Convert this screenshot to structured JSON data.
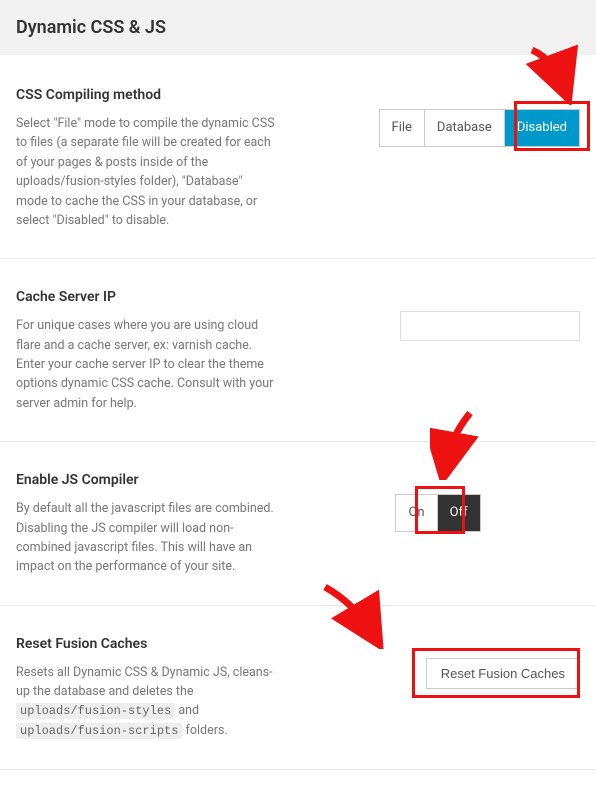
{
  "header": {
    "title": "Dynamic CSS & JS"
  },
  "css_compiling": {
    "title": "CSS Compiling method",
    "desc": "Select \"File\" mode to compile the dynamic CSS to files (a separate file will be created for each of your pages & posts inside of the uploads/fusion-styles folder), \"Database\" mode to cache the CSS in your database, or select \"Disabled\" to disable.",
    "options": {
      "file": "File",
      "database": "Database",
      "disabled": "Disabled"
    }
  },
  "cache_ip": {
    "title": "Cache Server IP",
    "desc": "For unique cases where you are using cloud flare and a cache server, ex: varnish cache. Enter your cache server IP to clear the theme options dynamic CSS cache. Consult with your server admin for help.",
    "value": ""
  },
  "js_compiler": {
    "title": "Enable JS Compiler",
    "desc": "By default all the javascript files are combined. Disabling the JS compiler will load non-combined javascript files. This will have an impact on the performance of your site.",
    "options": {
      "on": "On",
      "off": "Off"
    }
  },
  "reset_caches": {
    "title": "Reset Fusion Caches",
    "desc_pre": "Resets all Dynamic CSS & Dynamic JS, cleans-up the database and deletes the ",
    "code1": "uploads/fusion-styles",
    "mid": " and ",
    "code2": "uploads/fusion-scripts",
    "desc_post": " folders.",
    "button": "Reset Fusion Caches"
  }
}
